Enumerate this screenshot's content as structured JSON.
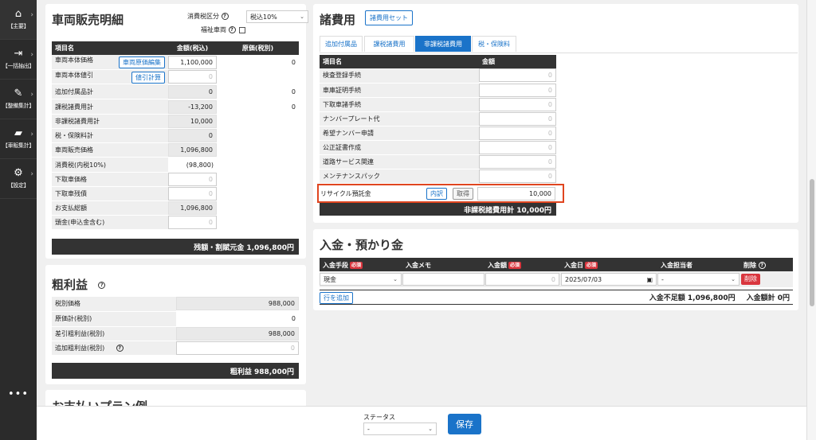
{
  "sidebar": {
    "items": [
      {
        "icon": "home-icon",
        "glyph": "⌂",
        "label": "【主要】"
      },
      {
        "icon": "export-icon",
        "glyph": "⇥",
        "label": "【一括抽出】"
      },
      {
        "icon": "wrench-icon",
        "glyph": "✎",
        "label": "【整備集計】"
      },
      {
        "icon": "car-icon",
        "glyph": "▰",
        "label": "【車販集計】"
      },
      {
        "icon": "gear-icon",
        "glyph": "⚙",
        "label": "【設定】"
      }
    ],
    "more": "•••"
  },
  "sales": {
    "title": "車両販売明細",
    "tax_label": "消費税区分",
    "tax_value": "税込10%",
    "welfare_label": "福祉車両",
    "col_item": "項目名",
    "col_amount": "金額(税込)",
    "col_cost": "原価(税別)",
    "rows": [
      {
        "label": "車両本体価格",
        "btn": "車両原価編集",
        "amount": "1,100,000",
        "cost": "0",
        "amount_style": "input",
        "cost_style": "text"
      },
      {
        "label": "車両本体値引",
        "btn": "値引計算",
        "amount": "0",
        "cost": "",
        "amount_style": "input-empty",
        "cost_style": "none"
      },
      {
        "label": "追加付属品計",
        "btn": "",
        "amount": "0",
        "cost": "0",
        "amount_style": "gray",
        "cost_style": "text"
      },
      {
        "label": "課税諸費用計",
        "btn": "",
        "amount": "-13,200",
        "cost": "0",
        "amount_style": "gray",
        "cost_style": "text"
      },
      {
        "label": "非課税諸費用計",
        "btn": "",
        "amount": "10,000",
        "cost": "",
        "amount_style": "gray",
        "cost_style": "none"
      },
      {
        "label": "税・保険料計",
        "btn": "",
        "amount": "0",
        "cost": "",
        "amount_style": "gray",
        "cost_style": "none"
      },
      {
        "label": "車両販売価格",
        "btn": "",
        "amount": "1,096,800",
        "cost": "",
        "amount_style": "gray",
        "cost_style": "none"
      },
      {
        "label": "消費税(内税10%)",
        "btn": "",
        "amount": "(98,800)",
        "cost": "",
        "amount_style": "plain",
        "cost_style": "none"
      },
      {
        "label": "下取車価格",
        "btn": "",
        "amount": "0",
        "cost": "",
        "amount_style": "input-empty",
        "cost_style": "none"
      },
      {
        "label": "下取車残債",
        "btn": "",
        "amount": "0",
        "cost": "",
        "amount_style": "input-empty",
        "cost_style": "none"
      },
      {
        "label": "お支払総額",
        "btn": "",
        "amount": "1,096,800",
        "cost": "",
        "amount_style": "gray",
        "cost_style": "none"
      },
      {
        "label": "頭金(申込金含む)",
        "btn": "",
        "amount": "0",
        "cost": "",
        "amount_style": "input-empty",
        "cost_style": "none"
      }
    ],
    "footer": "残額・割賦元金 1,096,800円"
  },
  "profit": {
    "title": "粗利益",
    "rows": [
      {
        "label": "税別価格",
        "value": "988,000",
        "style": "gray",
        "help": false
      },
      {
        "label": "原価計(税別)",
        "value": "0",
        "style": "plain",
        "help": false
      },
      {
        "label": "差引粗利益(税別)",
        "value": "988,000",
        "style": "gray",
        "help": false
      },
      {
        "label": "追加粗利益(税別)",
        "value": "0",
        "style": "input-empty",
        "help": true
      }
    ],
    "footer": "粗利益 988,000円",
    "next_title": "お支払いプラン例"
  },
  "fees": {
    "title": "諸費用",
    "set_button": "諸費用セット",
    "tabs": [
      {
        "label": "追加付属品",
        "active": false
      },
      {
        "label": "課税諸費用",
        "active": false
      },
      {
        "label": "非課税諸費用",
        "active": true
      },
      {
        "label": "税・保険料",
        "active": false
      }
    ],
    "col_item": "項目名",
    "col_amount": "金額",
    "rows": [
      {
        "label": "検査登録手続",
        "value": "0"
      },
      {
        "label": "車庫証明手続",
        "value": "0"
      },
      {
        "label": "下取車諸手続",
        "value": "0"
      },
      {
        "label": "ナンバープレート代",
        "value": "0"
      },
      {
        "label": "希望ナンバー申請",
        "value": "0"
      },
      {
        "label": "公正証書作成",
        "value": "0"
      },
      {
        "label": "道路サービス関連",
        "value": "0"
      },
      {
        "label": "メンテナンスパック",
        "value": "0"
      }
    ],
    "recycle": {
      "label": "リサイクル預託金",
      "detail_btn": "内訳",
      "fetch_btn": "取得",
      "value": "10,000"
    },
    "footer": "非課税諸費用計 10,000円"
  },
  "deposit": {
    "title": "入金・預かり金",
    "cols": {
      "method": "入金手段",
      "memo": "入金メモ",
      "amount": "入金額",
      "date": "入金日",
      "person": "入金担当者",
      "delete": "削除"
    },
    "required": "必須",
    "row": {
      "method": "現金",
      "memo": "",
      "amount": "0",
      "date": "2025/07/03",
      "person": "-",
      "delete_btn": "削除"
    },
    "add_row": "行を追加",
    "shortfall": "入金不足額 1,096,800円",
    "total": "入金額計 0円"
  },
  "bottom": {
    "status_label": "ステータス",
    "status_value": "-",
    "save": "保存"
  },
  "colors": {
    "accent": "#1a73c9",
    "danger": "#d9363e",
    "highlight": "#e0451f",
    "header": "#333333"
  }
}
